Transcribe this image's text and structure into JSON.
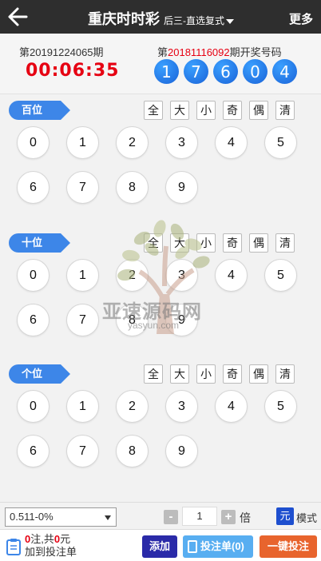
{
  "header": {
    "title": "重庆时时彩",
    "subtitle": "后三-直选复式",
    "more_label": "更多"
  },
  "info": {
    "current_issue": "第20191224065期",
    "countdown": "00:06:35",
    "last_prefix": "第",
    "last_issue_number": "20181116092",
    "last_suffix": "期开奖号码",
    "winning_numbers": [
      "1",
      "7",
      "6",
      "0",
      "4"
    ]
  },
  "sections": [
    {
      "label": "百位"
    },
    {
      "label": "十位"
    },
    {
      "label": "个位"
    }
  ],
  "filter_labels": [
    "全",
    "大",
    "小",
    "奇",
    "偶",
    "清"
  ],
  "digits": [
    "0",
    "1",
    "2",
    "3",
    "4",
    "5",
    "6",
    "7",
    "8",
    "9"
  ],
  "watermark": {
    "text": "亚速源码网",
    "url": "yasyun.com"
  },
  "bottom": {
    "odds_select": "0.511-0%",
    "minus": "-",
    "multiplier": "1",
    "plus": "+",
    "bei_label": "倍",
    "unit": "元",
    "mode_label": "模式",
    "bets_count": "0",
    "bets_unit": "注,共",
    "amount": "0",
    "amount_unit": "元",
    "add_to_list": "加到投注单",
    "add_button": "添加",
    "list_button": "投注单(0)",
    "one_click_button": "一键投注"
  },
  "colors": {
    "header_bg": "#2e2e2e",
    "accent_blue": "#3d86e8",
    "countdown_red": "#e60012",
    "add_btn": "#2a2aa8",
    "list_btn": "#58aef1",
    "one_click_btn": "#e8642d"
  }
}
